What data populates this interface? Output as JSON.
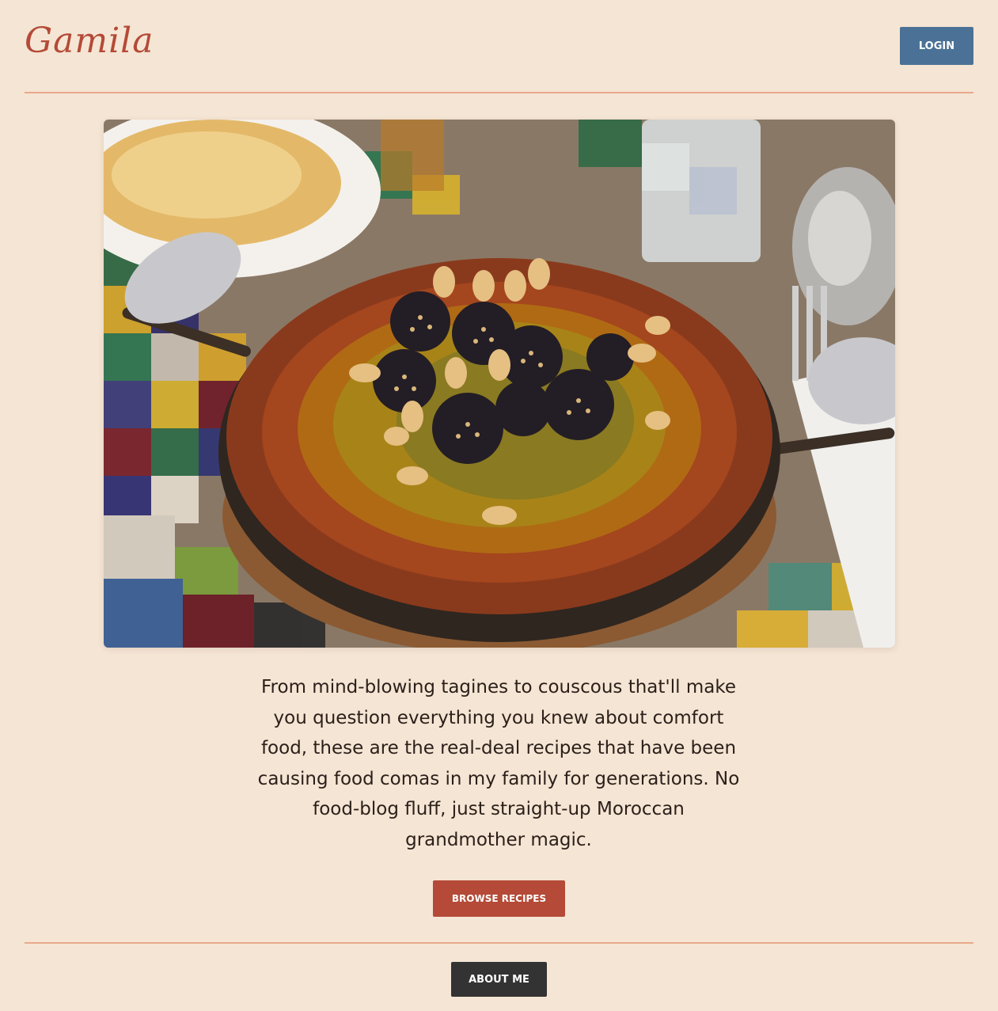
{
  "header": {
    "logo_text": "Gamila",
    "login_label": "LOGIN"
  },
  "hero": {
    "image_subject": "tagine-dish-photo"
  },
  "intro": {
    "text": "From mind-blowing tagines to couscous that'll make you question everything you knew about comfort food, these are the real-deal recipes that have been causing food comas in my family for generations. No food-blog fluff, just straight-up Moroccan grandmother magic."
  },
  "actions": {
    "browse_label": "BROWSE RECIPES",
    "about_label": "ABOUT ME"
  },
  "colors": {
    "background": "#f5e5d4",
    "accent": "#b44a37",
    "login_button": "#4b7296",
    "about_button": "#333333",
    "divider": "#e8a98a"
  }
}
